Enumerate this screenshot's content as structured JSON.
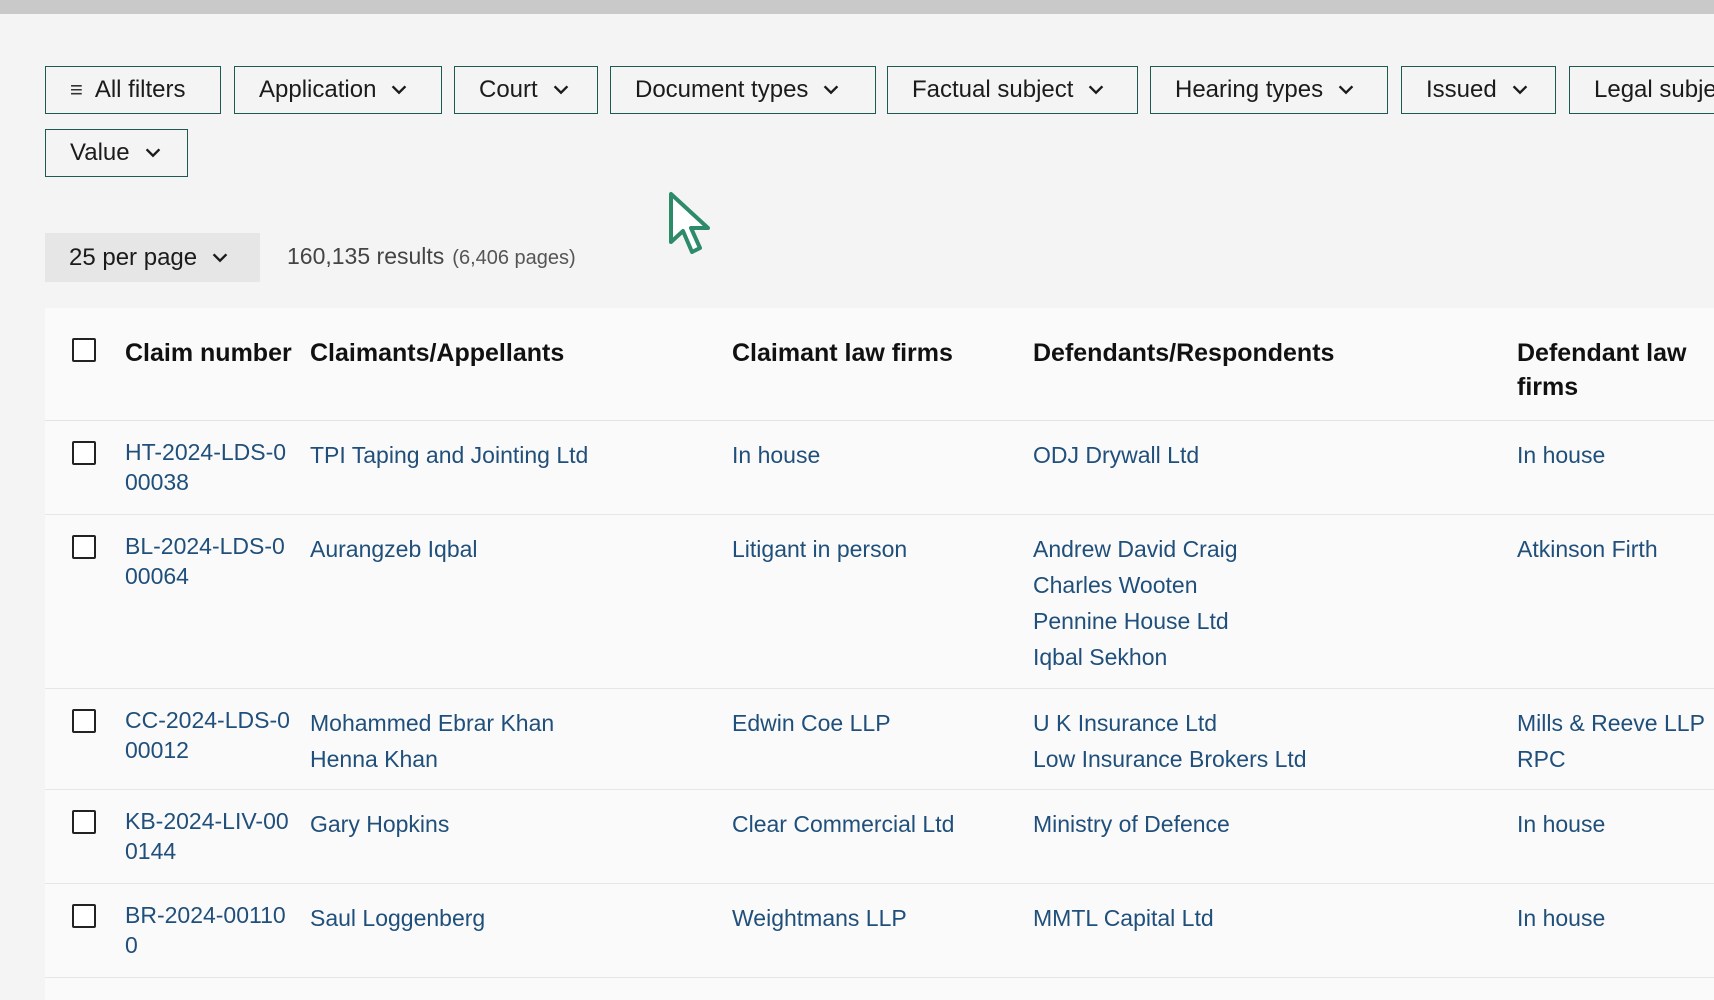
{
  "filters": [
    {
      "label": "All filters",
      "icon": "menu-icon"
    },
    {
      "label": "Application"
    },
    {
      "label": "Court"
    },
    {
      "label": "Document types"
    },
    {
      "label": "Factual subject"
    },
    {
      "label": "Hearing types"
    },
    {
      "label": "Issued"
    },
    {
      "label": "Legal subje"
    },
    {
      "label": "Value"
    }
  ],
  "paging": {
    "per_page": "25 per page",
    "results": "160,135 results",
    "pages": "(6,406 pages)"
  },
  "table": {
    "headers": {
      "claim_number": "Claim number",
      "claimants": "Claimants/Appellants",
      "claimant_firms": "Claimant law firms",
      "defendants": "Defendants/Respondents",
      "defendant_firms": "Defendant law firms"
    },
    "rows": [
      {
        "claim_number": "HT-2024-LDS-000038",
        "claimants": [
          "TPI Taping and Jointing Ltd"
        ],
        "claimant_firms": [
          "In house"
        ],
        "defendants": [
          "ODJ Drywall Ltd"
        ],
        "defendant_firms": [
          "In house"
        ]
      },
      {
        "claim_number": "BL-2024-LDS-000064",
        "claimants": [
          "Aurangzeb Iqbal"
        ],
        "claimant_firms": [
          "Litigant in person"
        ],
        "defendants": [
          "Andrew David Craig",
          "Charles Wooten",
          "Pennine House Ltd",
          "Iqbal Sekhon"
        ],
        "defendant_firms": [
          "Atkinson Firth"
        ]
      },
      {
        "claim_number": "CC-2024-LDS-000012",
        "claimants": [
          "Mohammed Ebrar Khan",
          "Henna Khan"
        ],
        "claimant_firms": [
          "Edwin Coe LLP"
        ],
        "defendants": [
          "U K Insurance Ltd",
          "Low Insurance Brokers Ltd"
        ],
        "defendant_firms": [
          "Mills & Reeve LLP",
          "RPC"
        ]
      },
      {
        "claim_number": "KB-2024-LIV-000144",
        "claimants": [
          "Gary Hopkins"
        ],
        "claimant_firms": [
          "Clear Commercial Ltd"
        ],
        "defendants": [
          "Ministry of Defence"
        ],
        "defendant_firms": [
          "In house"
        ]
      },
      {
        "claim_number": "BR-2024-001100",
        "claimants": [
          "Saul Loggenberg"
        ],
        "claimant_firms": [
          "Weightmans LLP"
        ],
        "defendants": [
          "MMTL Capital Ltd"
        ],
        "defendant_firms": [
          "In house"
        ]
      }
    ]
  },
  "colors": {
    "link": "#1f4f7a",
    "chip_border": "#1f5a52",
    "cursor": "#2e8b6a"
  }
}
